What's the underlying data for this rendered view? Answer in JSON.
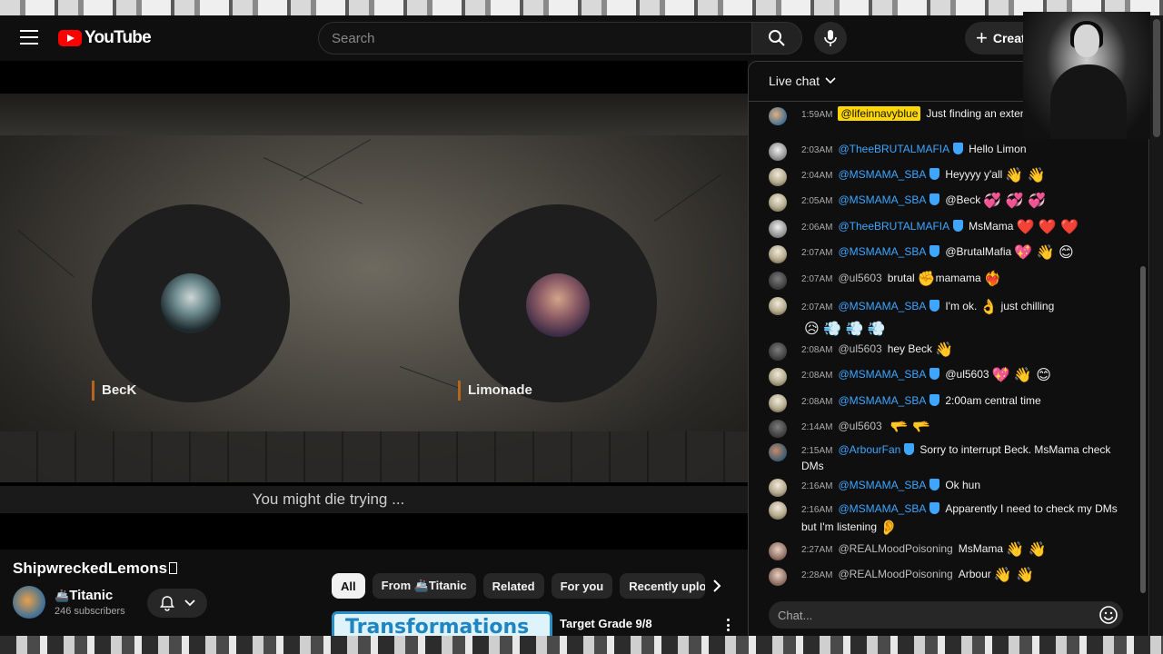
{
  "header": {
    "logo_text": "YouTube",
    "search_placeholder": "Search",
    "create_label": "Create"
  },
  "video": {
    "participants": [
      {
        "name": "BecK"
      },
      {
        "name": "Limonade"
      }
    ],
    "caption": "You might die trying ..."
  },
  "below_video": {
    "title": "ShipwreckedLemons",
    "channel_name": "Titanic",
    "channel_emoji": "🚢",
    "subscribers": "246 subscribers",
    "chips": [
      "All",
      "From 🚢Titanic",
      "Related",
      "For you",
      "Recently uploaded"
    ],
    "recommendation": {
      "thumb_text": "Transformations",
      "title": "Target Grade 9/8"
    }
  },
  "chat": {
    "title": "Live chat",
    "input_placeholder": "Chat...",
    "messages": [
      {
        "time": "1:59AM",
        "author": "@lifeinnavyblue",
        "text": "Just finding an extension for my phone.",
        "emoji": ""
      },
      {
        "time": "2:03AM",
        "author": "@TheeBRUTALMAFIA",
        "text": "Hello Limon",
        "emoji": ""
      },
      {
        "time": "2:04AM",
        "author": "@MSMAMA_SBA",
        "text": "Heyyyy y'all",
        "emoji": "👋 👋"
      },
      {
        "time": "2:05AM",
        "author": "@MSMAMA_SBA",
        "text": "@Beck",
        "emoji": "💞 💞 💞"
      },
      {
        "time": "2:06AM",
        "author": "@TheeBRUTALMAFIA",
        "text": "MsMama",
        "emoji": "❤️ ❤️ ❤️"
      },
      {
        "time": "2:07AM",
        "author": "@MSMAMA_SBA",
        "text": "@BrutalMafia",
        "emoji": "💖 👋 😊"
      },
      {
        "time": "2:07AM",
        "author": "@ul5603",
        "text": "brutal",
        "emoji": "✊",
        "text2": "mamama",
        "emoji2": "❤️‍🔥"
      },
      {
        "time": "2:07AM",
        "author": "@MSMAMA_SBA",
        "text": "I'm ok.",
        "emoji": "👌",
        "text2": "just chilling",
        "emoji2": "😥 💨 💨 💨"
      },
      {
        "time": "2:08AM",
        "author": "@ul5603",
        "text": "hey Beck",
        "emoji": "👋"
      },
      {
        "time": "2:08AM",
        "author": "@MSMAMA_SBA",
        "text": "@ul5603",
        "emoji": "💖 👋 😊"
      },
      {
        "time": "2:08AM",
        "author": "@MSMAMA_SBA",
        "text": "2:00am central time",
        "emoji": ""
      },
      {
        "time": "2:14AM",
        "author": "@ul5603",
        "text": "",
        "emoji": "🫳 🫳"
      },
      {
        "time": "2:15AM",
        "author": "@ArbourFan",
        "text": "Sorry to interrupt Beck. MsMama check DMs",
        "emoji": ""
      },
      {
        "time": "2:16AM",
        "author": "@MSMAMA_SBA",
        "text": "Ok hun",
        "emoji": ""
      },
      {
        "time": "2:16AM",
        "author": "@MSMAMA_SBA",
        "text": "Apparently I need to check my DMs but I'm listening",
        "emoji": "👂"
      },
      {
        "time": "2:27AM",
        "author": "@REALMoodPoisoning",
        "text": "MsMama",
        "emoji": "👋 👋"
      },
      {
        "time": "2:28AM",
        "author": "@REALMoodPoisoning",
        "text": "Arbour",
        "emoji": "👋 👋"
      }
    ]
  }
}
